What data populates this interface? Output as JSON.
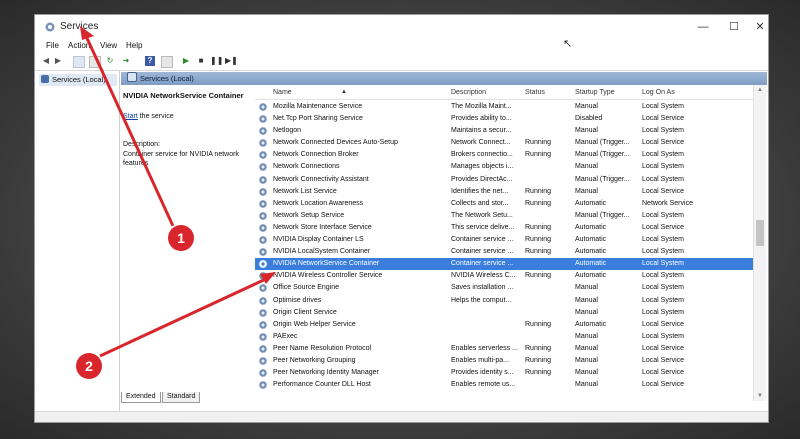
{
  "window": {
    "title": "Services"
  },
  "menu": [
    "File",
    "Action",
    "View",
    "Help"
  ],
  "tree": {
    "root_label": "Services (Local)"
  },
  "header": {
    "title": "Services (Local)"
  },
  "detail": {
    "service_name": "NVIDIA NetworkService Container",
    "start_link": "Start",
    "start_suffix": " the service",
    "description_label": "Description:",
    "description_text": "Container service for NVIDIA network features"
  },
  "columns": [
    "Name",
    "Description",
    "Status",
    "Startup Type",
    "Log On As"
  ],
  "services": [
    [
      "Mozilla Maintenance Service",
      "The Mozilla Maint...",
      "",
      "Manual",
      "Local System"
    ],
    [
      "Net.Tcp Port Sharing Service",
      "Provides ability to...",
      "",
      "Disabled",
      "Local Service"
    ],
    [
      "Netlogon",
      "Maintains a secur...",
      "",
      "Manual",
      "Local System"
    ],
    [
      "Network Connected Devices Auto-Setup",
      "Network Connect...",
      "Running",
      "Manual (Trigger...",
      "Local Service"
    ],
    [
      "Network Connection Broker",
      "Brokers connectio...",
      "Running",
      "Manual (Trigger...",
      "Local System"
    ],
    [
      "Network Connections",
      "Manages objects i...",
      "",
      "Manual",
      "Local System"
    ],
    [
      "Network Connectivity Assistant",
      "Provides DirectAc...",
      "",
      "Manual (Trigger...",
      "Local System"
    ],
    [
      "Network List Service",
      "Identifies the net...",
      "Running",
      "Manual",
      "Local Service"
    ],
    [
      "Network Location Awareness",
      "Collects and stor...",
      "Running",
      "Automatic",
      "Network Service"
    ],
    [
      "Network Setup Service",
      "The Network Setu...",
      "",
      "Manual (Trigger...",
      "Local System"
    ],
    [
      "Network Store Interface Service",
      "This service delive...",
      "Running",
      "Automatic",
      "Local Service"
    ],
    [
      "NVIDIA Display Container LS",
      "Container service ...",
      "Running",
      "Automatic",
      "Local System"
    ],
    [
      "NVIDIA LocalSystem Container",
      "Container service ...",
      "Running",
      "Automatic",
      "Local System"
    ],
    [
      "NVIDIA NetworkService Container",
      "Container service ...",
      "",
      "Automatic",
      "Local System"
    ],
    [
      "NVIDIA Wireless Controller Service",
      "NVIDIA Wireless C...",
      "Running",
      "Automatic",
      "Local System"
    ],
    [
      "Office Source Engine",
      "Saves installation ...",
      "",
      "Manual",
      "Local System"
    ],
    [
      "Optimise drives",
      "Helps the comput...",
      "",
      "Manual",
      "Local System"
    ],
    [
      "Origin Client Service",
      "",
      "",
      "Manual",
      "Local System"
    ],
    [
      "Origin Web Helper Service",
      "",
      "Running",
      "Automatic",
      "Local Service"
    ],
    [
      "PAExec",
      "",
      "",
      "Manual",
      "Local System"
    ],
    [
      "Peer Name Resolution Protocol",
      "Enables serverless ...",
      "Running",
      "Manual",
      "Local Service"
    ],
    [
      "Peer Networking Grouping",
      "Enables multi-pa...",
      "Running",
      "Manual",
      "Local Service"
    ],
    [
      "Peer Networking Identity Manager",
      "Provides identity s...",
      "Running",
      "Manual",
      "Local Service"
    ],
    [
      "Performance Counter DLL Host",
      "Enables remote us...",
      "",
      "Manual",
      "Local Service"
    ]
  ],
  "selected_index": 13,
  "tabs": [
    "Extended",
    "Standard"
  ],
  "annotations": [
    "1",
    "2"
  ],
  "colors": {
    "selection": "#3b7ddd",
    "header": "#8fa9cd",
    "badge": "#d9262c",
    "arrow": "#d9262c"
  }
}
